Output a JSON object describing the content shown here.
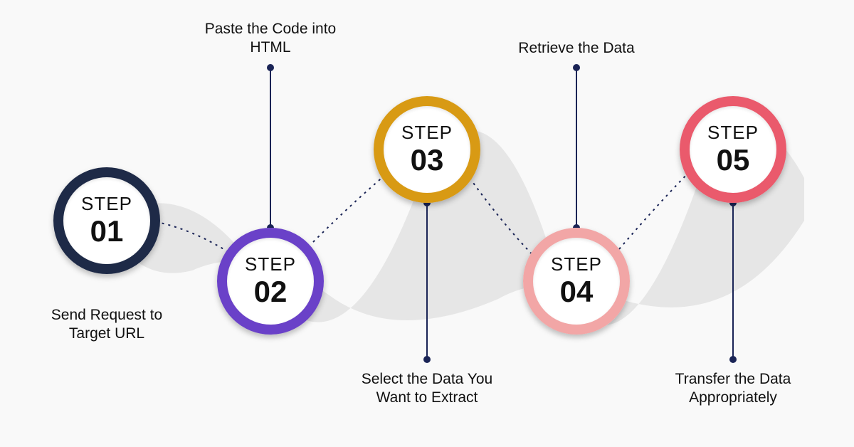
{
  "steps": [
    {
      "word": "STEP",
      "num": "01",
      "caption": "Send Request to Target URL",
      "color": "#1e2a47"
    },
    {
      "word": "STEP",
      "num": "02",
      "caption": "Paste the Code into HTML",
      "color": "#6a41c8"
    },
    {
      "word": "STEP",
      "num": "03",
      "caption": "Select the Data You Want to Extract",
      "color": "#d89a14"
    },
    {
      "word": "STEP",
      "num": "04",
      "caption": "Retrieve the Data",
      "color": "#f2a6a6"
    },
    {
      "word": "STEP",
      "num": "05",
      "caption": "Transfer the Data Appropriately",
      "color": "#ea5a6c"
    }
  ]
}
